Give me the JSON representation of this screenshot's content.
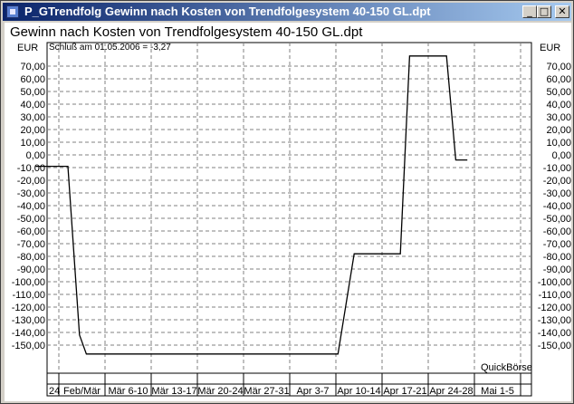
{
  "window": {
    "title": "P_GTrendfolg Gewinn nach Kosten von Trendfolgesystem 40-150 GL.dpt",
    "controls": {
      "minimize": "_",
      "maximize": "□",
      "close": "✕"
    }
  },
  "header": {
    "title": "Gewinn nach Kosten von Trendfolgesystem 40-150 GL.dpt",
    "unit_left": "EUR",
    "unit_right": "EUR",
    "note": "Schluß am 01.05.2006 = -3,27",
    "brand": "QuickBörse"
  },
  "chart_data": {
    "type": "line",
    "title": "Gewinn nach Kosten von Trendfolgesystem 40-150 GL.dpt",
    "ylabel": "EUR",
    "ylim": [
      -160,
      80
    ],
    "y_ticks": [
      70,
      60,
      50,
      40,
      30,
      20,
      10,
      0,
      -10,
      -20,
      -30,
      -40,
      -50,
      -60,
      -70,
      -80,
      -90,
      -100,
      -110,
      -120,
      -130,
      -140,
      -150
    ],
    "y_tick_labels": [
      "70,00",
      "60,00",
      "50,00",
      "40,00",
      "30,00",
      "20,00",
      "10,00",
      "0,00",
      "-10,00",
      "-20,00",
      "-30,00",
      "-40,00",
      "-50,00",
      "-60,00",
      "-70,00",
      "-80,00",
      "-90,00",
      "-100,00",
      "-110,00",
      "-120,00",
      "-130,00",
      "-140,00",
      "-150,00"
    ],
    "x_categories": [
      "24",
      "Feb/Mär",
      "Mär 6-10",
      "Mär 13-17",
      "Mär 20-24",
      "Mär 27-31",
      "Apr 3-7",
      "Apr 10-14",
      "Apr 17-21",
      "Apr 24-28",
      "Mai 1-5"
    ],
    "grid": true,
    "series": [
      {
        "color": "#000000",
        "points": [
          [
            0.3,
            -9
          ],
          [
            1.0,
            -9
          ],
          [
            1.25,
            -142
          ],
          [
            1.4,
            -157
          ],
          [
            2.0,
            -157
          ],
          [
            3.0,
            -157
          ],
          [
            4.0,
            -157
          ],
          [
            5.0,
            -157
          ],
          [
            6.0,
            -157
          ],
          [
            6.85,
            -157
          ],
          [
            7.2,
            -78
          ],
          [
            8.0,
            -78
          ],
          [
            8.2,
            -78
          ],
          [
            8.4,
            78
          ],
          [
            9.2,
            78
          ],
          [
            9.4,
            -4
          ],
          [
            9.65,
            -4
          ]
        ]
      }
    ],
    "last_value": -3.27
  }
}
